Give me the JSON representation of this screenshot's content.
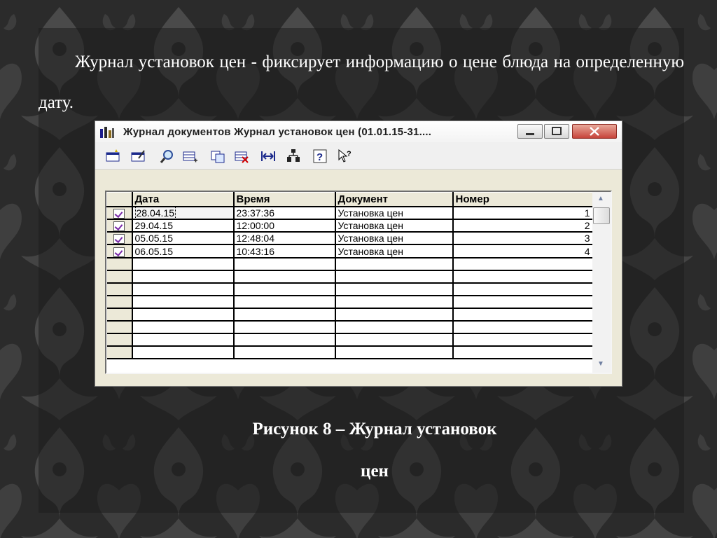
{
  "slide": {
    "intro_text": "Журнал установок цен - фиксирует информацию о цене блюда на определенную дату.",
    "caption_line1": "Рисунок 8 – Журнал установок",
    "caption_line2": "цен"
  },
  "window": {
    "title": "Журнал документов  Журнал установок цен (01.01.15-31....",
    "toolbar_icons": [
      "new-doc-icon",
      "edit-doc-icon",
      "find-icon",
      "add-row-icon",
      "copy-icon",
      "delete-icon",
      "interval-icon",
      "tree-icon",
      "help-icon",
      "whats-this-icon"
    ]
  },
  "grid": {
    "columns": [
      "Дата",
      "Время",
      "Документ",
      "Номер"
    ],
    "rows": [
      {
        "date": "28.04.15",
        "time": "23:37:36",
        "document": "Установка цен",
        "number": "1"
      },
      {
        "date": "29.04.15",
        "time": "12:00:00",
        "document": "Установка цен",
        "number": "2"
      },
      {
        "date": "05.05.15",
        "time": "12:48:04",
        "document": "Установка цен",
        "number": "3"
      },
      {
        "date": "06.05.15",
        "time": "10:43:16",
        "document": "Установка цен",
        "number": "4"
      }
    ],
    "empty_rows": 8
  },
  "colors": {
    "background": "#2c2c2c",
    "window_face": "#ece9d8",
    "close_button": "#c7443a",
    "doc_check": "#7a2aa8"
  }
}
